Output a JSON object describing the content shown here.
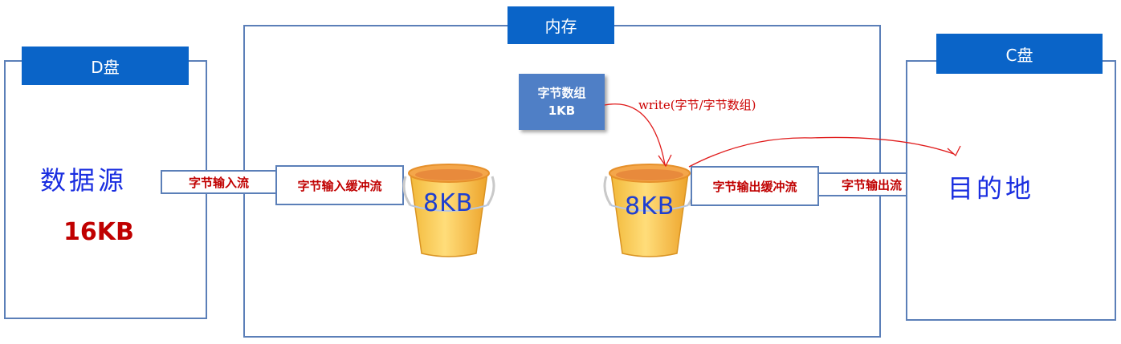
{
  "d_drive": {
    "title": "D盘",
    "source_label": "数据源",
    "size": "16KB"
  },
  "memory": {
    "title": "内存",
    "byte_array": {
      "line1": "字节数组",
      "line2": "1KB"
    },
    "write_label": "write(字节/字节数组)",
    "input_buffer": {
      "label": "字节输入缓冲流",
      "capacity": "8KB"
    },
    "output_buffer": {
      "label": "字节输出缓冲流",
      "capacity": "8KB"
    }
  },
  "streams": {
    "input": "字节输入流",
    "output": "字节输出流"
  },
  "c_drive": {
    "title": "C盘",
    "dest_label": "目的地"
  },
  "colors": {
    "title_bg": "#0a64c8",
    "stream_text": "#c00000",
    "arrow": "#e01b1b",
    "handwriting": "#1a2ee0"
  }
}
